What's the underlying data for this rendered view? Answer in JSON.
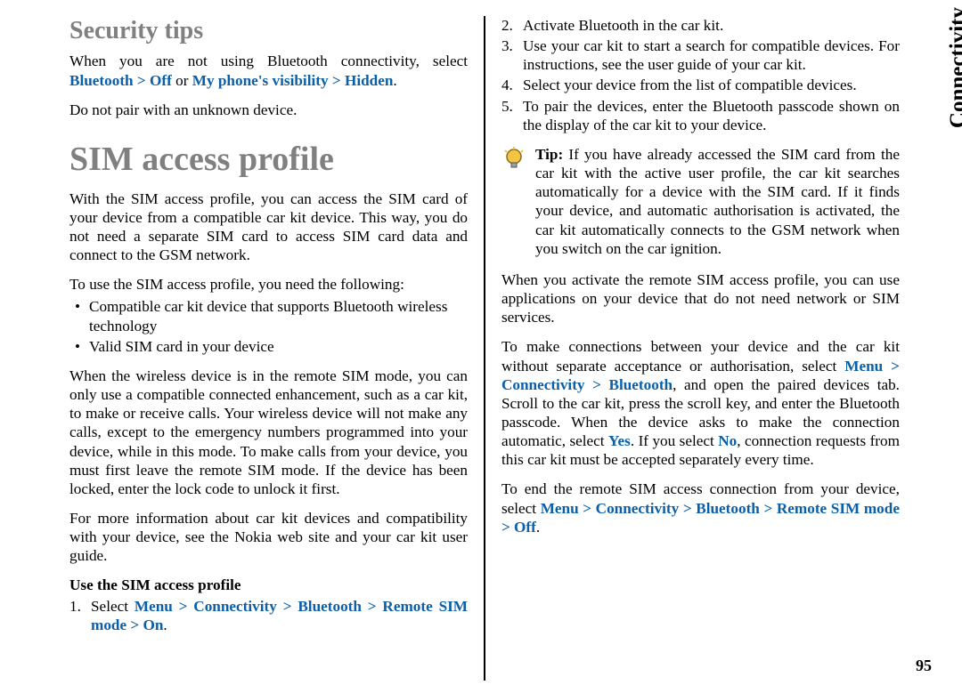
{
  "side_tab": "Connectivity",
  "page_number": "95",
  "left": {
    "security_tips_heading": "Security tips",
    "sec_tip_line1a": "When you are not using Bluetooth connectivity, select ",
    "sec_tip_path1": "Bluetooth  >  Off",
    "sec_tip_or": " or ",
    "sec_tip_path2": "My phone's visibility  >  Hidden",
    "sec_tip_period": ".",
    "sec_tip_line2": "Do not pair with an unknown device.",
    "sim_heading": "SIM access profile",
    "sim_intro": "With the SIM access profile, you can access the SIM card of your device from a compatible car kit device. This way, you do not need a separate SIM card to access SIM card data and connect to the GSM network.",
    "sim_need_intro": "To use the SIM access profile, you need the following:",
    "sim_need_bullet1": "Compatible car kit device that supports Bluetooth wireless technology",
    "sim_need_bullet2": "Valid SIM card in your device",
    "sim_remote_para": "When the wireless device is in the remote SIM mode, you can only use a compatible connected enhancement, such as a car kit, to make or receive calls. Your wireless device will not make any calls, except to the emergency numbers programmed into your device, while in this mode. To make calls from your device, you must first leave the remote SIM mode. If the device has been locked, enter the lock code to unlock it first.",
    "sim_moreinfo": "For more information about car kit devices and compatibility with your device, see the Nokia web site and your car kit user guide.",
    "use_sim_heading": "Use the SIM access profile",
    "step1_a": "Select ",
    "step1_path": "Menu  >  Connectivity  >  Bluetooth  >  Remote SIM mode  >  On",
    "step1_period": "."
  },
  "right": {
    "step2": "Activate Bluetooth in the car kit.",
    "step3": "Use your car kit to start a search for compatible devices. For instructions, see the user guide of your car kit.",
    "step4": "Select your device from the list of compatible devices.",
    "step5": "To pair the devices, enter the Bluetooth passcode shown on the display of the car kit to your device.",
    "tip_label": "Tip: ",
    "tip_body": "If you have already accessed the SIM card from the car kit with the active user profile, the car kit searches automatically for a device with the SIM card. If it finds your device, and automatic authorisation is activated, the car kit automatically connects to the GSM network when you switch on the car ignition.",
    "activate_para": "When you activate the remote SIM access profile, you can use applications on your device that do not need network or SIM services.",
    "make_conn_a": "To make connections between your device and the car kit without separate acceptance or authorisation, select ",
    "make_conn_path": "Menu  >  Connectivity  >  Bluetooth",
    "make_conn_b": ", and open the paired devices tab. Scroll to the car kit, press the scroll key, and enter the Bluetooth passcode. When the device asks to make the connection automatic, select ",
    "make_conn_yes": "Yes",
    "make_conn_c": ". If you select ",
    "make_conn_no": "No",
    "make_conn_d": ", connection requests from this car kit must be accepted separately every time.",
    "end_a": "To end the remote SIM access connection from your device, select ",
    "end_path": "Menu  >  Connectivity  >  Bluetooth  >  Remote SIM mode  >  Off",
    "end_period": "."
  }
}
